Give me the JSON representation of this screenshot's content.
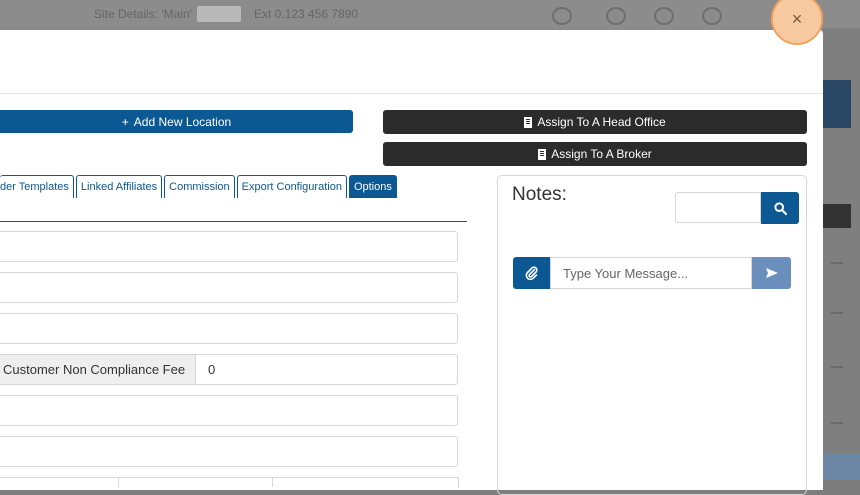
{
  "background": {
    "topbar_text": "Site Details: 'Main'",
    "topbar_text2": "Ext 0.123 456 7890"
  },
  "modal": {
    "close_glyph": "×",
    "buttons": {
      "add_location": "Add New Location",
      "assign_head_office": "Assign To A Head Office",
      "assign_broker": "Assign To A Broker"
    },
    "tabs": [
      {
        "label": "der Templates"
      },
      {
        "label": "Linked Affiliates"
      },
      {
        "label": "Commission"
      },
      {
        "label": "Export Configuration"
      },
      {
        "label": "Options"
      }
    ],
    "fields": {
      "fee_label": "Customer Non Compliance Fee",
      "fee_value": "0"
    },
    "notes": {
      "title": "Notes:",
      "search_value": "",
      "message_placeholder": "Type Your Message..."
    }
  },
  "colors": {
    "primary": "#0b5893",
    "dark_button": "#2b2b2b",
    "send_button": "#6a8fbd",
    "close_highlight": "#f7c9a1"
  },
  "icons": {
    "add": "plus-icon",
    "building": "building-icon",
    "search": "search-icon",
    "attach": "paperclip-icon",
    "send": "send-icon",
    "close": "close-icon"
  }
}
